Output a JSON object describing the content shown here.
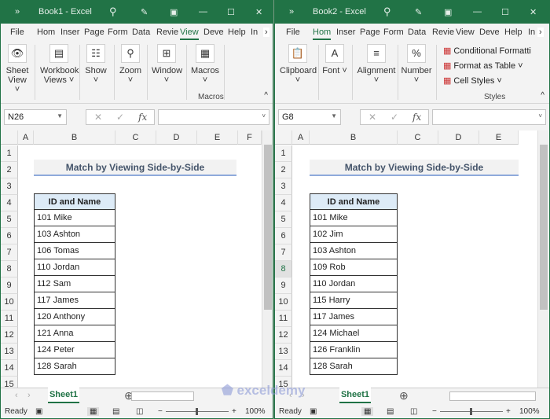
{
  "windows": [
    {
      "id": "w1",
      "title": "Book1  -  Excel",
      "tabs": [
        "File",
        "Hom",
        "Inser",
        "Page",
        "Form",
        "Data",
        "Revie",
        "View",
        "Deve",
        "Help",
        "In"
      ],
      "active_tab": 7,
      "ribbon": [
        {
          "label": "Sheet View ˅",
          "icon": "👁",
          "name": "sheet-view"
        },
        {
          "label": "Workbook Views ˅",
          "icon": "▤",
          "name": "workbook-views"
        },
        {
          "label": "Show ˅",
          "icon": "☷",
          "name": "show"
        },
        {
          "label": "Zoom ˅",
          "icon": "⚲",
          "name": "zoom"
        },
        {
          "label": "Window ˅",
          "icon": "⊞",
          "name": "window"
        },
        {
          "label": "Macros ˅",
          "icon": "▦",
          "name": "macros"
        }
      ],
      "group_label": "Macros",
      "name_box": "N26",
      "columns": [
        "A",
        "B",
        "C",
        "D",
        "E",
        "F"
      ],
      "rows": [
        "1",
        "2",
        "3",
        "4",
        "5",
        "6",
        "7",
        "8",
        "9",
        "10",
        "11",
        "12",
        "13",
        "14",
        "15"
      ],
      "selected_row": null,
      "sheet_title": "Match by Viewing Side-by-Side",
      "table_header": "ID and Name",
      "entries": [
        "101 Mike",
        "103 Ashton",
        "106 Tomas",
        "110 Jordan",
        "112 Sam",
        "117 James",
        "120 Anthony",
        "121 Anna",
        "124 Peter",
        "128 Sarah"
      ],
      "sheet_tab": "Sheet1",
      "status": "Ready",
      "zoom": "100%"
    },
    {
      "id": "w2",
      "title": "Book2  -  Excel",
      "tabs": [
        "File",
        "Hom",
        "Inser",
        "Page",
        "Form",
        "Data",
        "Revie",
        "View",
        "Deve",
        "Help",
        "In"
      ],
      "active_tab": 1,
      "ribbon": [
        {
          "label": "Clipboard ˅",
          "icon": "📋",
          "name": "clipboard"
        },
        {
          "label": "Font ˅",
          "icon": "A",
          "name": "font"
        },
        {
          "label": "Alignment ˅",
          "icon": "≡",
          "name": "alignment"
        },
        {
          "label": "Number ˅",
          "icon": "%",
          "name": "number"
        }
      ],
      "styles": [
        "Conditional Formatti",
        "Format as Table ˅",
        "Cell Styles ˅"
      ],
      "group_label": "Styles",
      "name_box": "G8",
      "columns": [
        "A",
        "B",
        "C",
        "D",
        "E"
      ],
      "rows": [
        "1",
        "2",
        "3",
        "4",
        "5",
        "6",
        "7",
        "8",
        "9",
        "10",
        "11",
        "12",
        "13",
        "14",
        "15"
      ],
      "selected_row": 7,
      "sheet_title": "Match by Viewing Side-by-Side",
      "table_header": "ID and Name",
      "entries": [
        "101 Mike",
        "102 Jim",
        "103 Ashton",
        "109 Rob",
        "110 Jordan",
        "115 Harry",
        "117 James",
        "124 Michael",
        "126 Franklin",
        "128 Sarah"
      ],
      "sheet_tab": "Sheet1",
      "status": "Ready",
      "zoom": "100%"
    }
  ],
  "watermark": "exceldemy EXCEL · DATA · BI"
}
